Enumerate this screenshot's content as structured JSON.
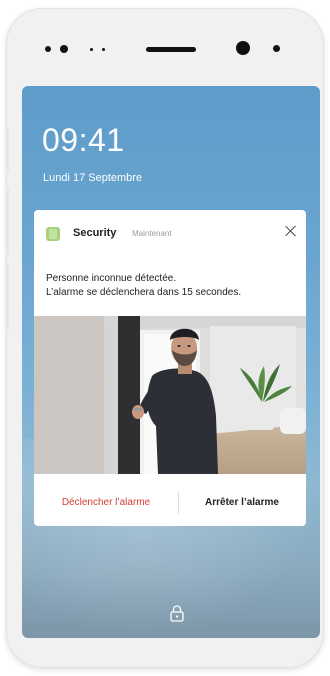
{
  "lockscreen": {
    "time": "09:41",
    "date": "Lundi 17 Septembre"
  },
  "notification": {
    "app_icon": "security-app-icon",
    "app_name": "Security",
    "timestamp": "Maintenant",
    "message_line_1": "Personne inconnue détectée.",
    "message_line_2": "L’alarme se déclenchera dans 15 secondes.",
    "actions": {
      "trigger_label": "Déclencher l’alarme",
      "stop_label": "Arrêter l’alarme"
    }
  },
  "icons": [
    "close-icon",
    "lock-icon",
    "camera-icon"
  ],
  "colors": {
    "trigger_action": "#d0403a",
    "app_icon": "#a8d07d"
  }
}
